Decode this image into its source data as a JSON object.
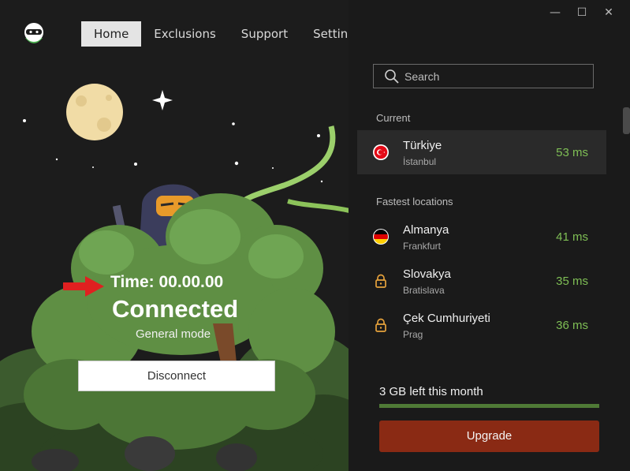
{
  "nav": {
    "tabs": [
      {
        "label": "Home"
      },
      {
        "label": "Exclusions"
      },
      {
        "label": "Support"
      },
      {
        "label": "Settings"
      }
    ]
  },
  "status": {
    "timer": "Time: 00.00.00",
    "state": "Connected",
    "mode": "General mode",
    "disconnect_label": "Disconnect"
  },
  "search": {
    "placeholder": "Search"
  },
  "current": {
    "label": "Current",
    "country": "Türkiye",
    "city": "İstanbul",
    "ping": "53 ms",
    "flag_icon": "turkey-flag-icon"
  },
  "fastest": {
    "label": "Fastest locations",
    "items": [
      {
        "country": "Almanya",
        "city": "Frankfurt",
        "ping": "41 ms",
        "icon": "germany-flag-icon"
      },
      {
        "country": "Slovakya",
        "city": "Bratislava",
        "ping": "35 ms",
        "icon": "lock-icon"
      },
      {
        "country": "Çek Cumhuriyeti",
        "city": "Prag",
        "ping": "36 ms",
        "icon": "lock-icon"
      }
    ]
  },
  "data_usage": {
    "label": "3 GB left this month",
    "fraction_left": 1.0
  },
  "upgrade_label": "Upgrade",
  "colors": {
    "accent_green": "#7fbf55",
    "upgrade": "#8a2a14",
    "lock": "#e6a23c",
    "turkey_red": "#e30a17"
  }
}
